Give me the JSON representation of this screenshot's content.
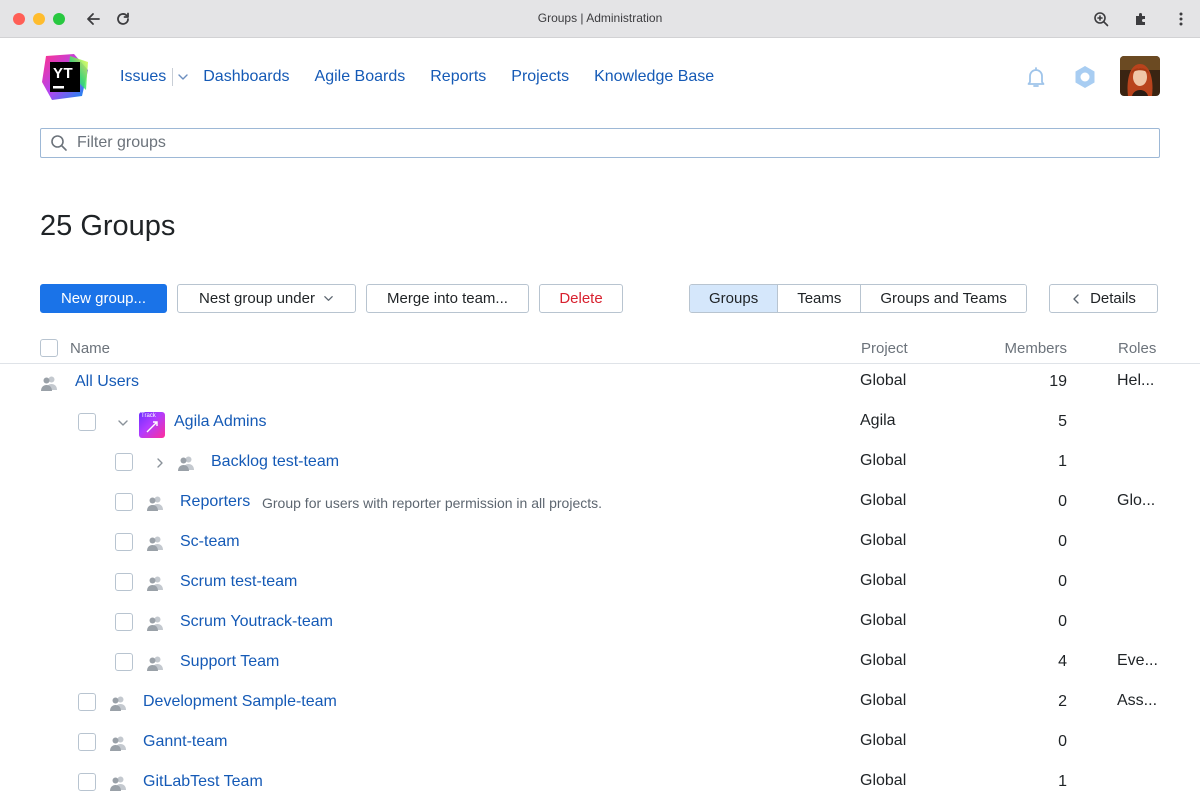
{
  "browser": {
    "title": "Groups | Administration"
  },
  "header": {
    "logo_text": "YT",
    "nav": [
      {
        "label": "Issues"
      },
      {
        "label": "Dashboards"
      },
      {
        "label": "Agile Boards"
      },
      {
        "label": "Reports"
      },
      {
        "label": "Projects"
      },
      {
        "label": "Knowledge Base"
      }
    ]
  },
  "filter": {
    "placeholder": "Filter groups"
  },
  "page": {
    "title": "25 Groups"
  },
  "toolbar": {
    "new_group": "New group...",
    "nest_group": "Nest group under",
    "merge": "Merge into team...",
    "delete": "Delete",
    "view_tabs": [
      "Groups",
      "Teams",
      "Groups and Teams"
    ],
    "active_tab": "Groups",
    "details": "Details"
  },
  "table": {
    "headers": {
      "name": "Name",
      "project": "Project",
      "members": "Members",
      "roles": "Roles"
    },
    "rows": [
      {
        "name": "All Users",
        "desc": "",
        "project": "Global",
        "members": "19",
        "roles": "Hel..."
      },
      {
        "name": "Agila Admins",
        "desc": "",
        "project": "Agila",
        "members": "5",
        "roles": "",
        "project_icon_text": "Track"
      },
      {
        "name": "Backlog test-team",
        "desc": "",
        "project": "Global",
        "members": "1",
        "roles": ""
      },
      {
        "name": "Reporters",
        "desc": "Group for users with reporter permission in all projects.",
        "project": "Global",
        "members": "0",
        "roles": "Glo..."
      },
      {
        "name": "Sc-team",
        "desc": "",
        "project": "Global",
        "members": "0",
        "roles": ""
      },
      {
        "name": "Scrum test-team",
        "desc": "",
        "project": "Global",
        "members": "0",
        "roles": ""
      },
      {
        "name": "Scrum Youtrack-team",
        "desc": "",
        "project": "Global",
        "members": "0",
        "roles": ""
      },
      {
        "name": "Support Team",
        "desc": "",
        "project": "Global",
        "members": "4",
        "roles": "Eve..."
      },
      {
        "name": "Development Sample-team",
        "desc": "",
        "project": "Global",
        "members": "2",
        "roles": "Ass..."
      },
      {
        "name": "Gannt-team",
        "desc": "",
        "project": "Global",
        "members": "0",
        "roles": ""
      },
      {
        "name": "GitLabTest Team",
        "desc": "",
        "project": "Global",
        "members": "1",
        "roles": ""
      }
    ]
  },
  "colors": {
    "link": "#155ab6",
    "primary": "#1a73e8",
    "danger": "#d8212f",
    "active_tab_bg": "#d5e7fb"
  }
}
